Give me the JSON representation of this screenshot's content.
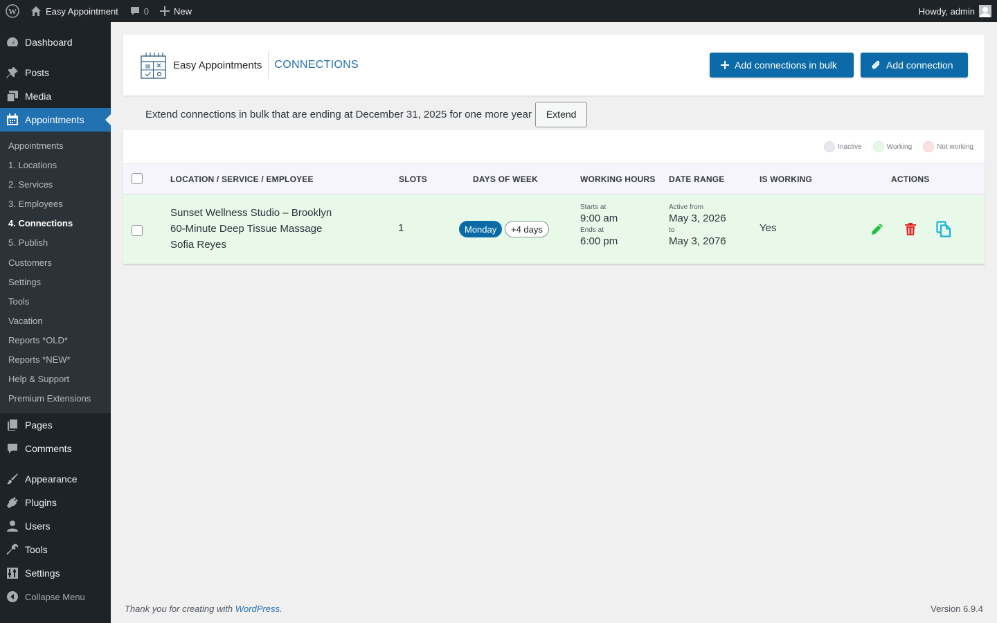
{
  "adminbar": {
    "site_name": "Easy Appointment",
    "comments_count": "0",
    "new_label": "New",
    "greeting": "Howdy, admin"
  },
  "sidebar": {
    "items_top": [
      {
        "label": "Dashboard",
        "icon": "dashboard-icon"
      },
      {
        "label": "Posts",
        "icon": "pin-icon"
      },
      {
        "label": "Media",
        "icon": "media-icon"
      },
      {
        "label": "Appointments",
        "icon": "calendar-icon"
      }
    ],
    "submenu": [
      "Appointments",
      "1. Locations",
      "2. Services",
      "3. Employees",
      "4. Connections",
      "5. Publish",
      "Customers",
      "Settings",
      "Tools",
      "Vacation",
      "Reports *OLD*",
      "Reports *NEW*",
      "Help & Support",
      "Premium Extensions"
    ],
    "items_bottom": [
      {
        "label": "Pages",
        "icon": "pages-icon"
      },
      {
        "label": "Comments",
        "icon": "comment-icon"
      },
      {
        "label": "Appearance",
        "icon": "brush-icon"
      },
      {
        "label": "Plugins",
        "icon": "plug-icon"
      },
      {
        "label": "Users",
        "icon": "user-icon"
      },
      {
        "label": "Tools",
        "icon": "wrench-icon"
      },
      {
        "label": "Settings",
        "icon": "sliders-icon"
      },
      {
        "label": "Collapse Menu",
        "icon": "collapse-icon"
      }
    ]
  },
  "header": {
    "brand": "Easy Appointments",
    "title": "CONNECTIONS",
    "bulk_button": "Add connections in bulk",
    "add_button": "Add connection"
  },
  "extend": {
    "text": "Extend connections in bulk that are ending at December 31, 2025 for one more year",
    "button": "Extend"
  },
  "legend": {
    "inactive": "Inactive",
    "working": "Working",
    "not_working": "Not working",
    "colors": {
      "inactive": "#e8e9ef",
      "working": "#e3f8e6",
      "not_working": "#fbe0e2"
    }
  },
  "table": {
    "columns": [
      "LOCATION / SERVICE / EMPLOYEE",
      "SLOTS",
      "DAYS OF WEEK",
      "WORKING HOURS",
      "DATE RANGE",
      "IS WORKING",
      "ACTIONS"
    ],
    "rows": [
      {
        "location": "Sunset Wellness Studio – Brooklyn",
        "service": "60-Minute Deep Tissue Massage",
        "employee": "Sofia Reyes",
        "slots": "1",
        "day": "Monday",
        "more_days": "+4 days",
        "starts_label": "Starts at",
        "starts": "9:00 am",
        "ends_label": "Ends at",
        "ends": "6:00 pm",
        "from_label": "Active from",
        "from": "May 3, 2026",
        "to_label": "to",
        "to": "May 3, 2076",
        "is_working": "Yes"
      }
    ]
  },
  "footer": {
    "thanks_prefix": "Thank you for creating with ",
    "thanks_link": "WordPress",
    "thanks_suffix": ".",
    "version": "Version 6.9.4"
  },
  "colors": {
    "accent": "#2271b1",
    "button": "#0b6aa7",
    "edit": "#1fbf3f",
    "delete": "#e02424",
    "copy": "#17b3d8"
  }
}
